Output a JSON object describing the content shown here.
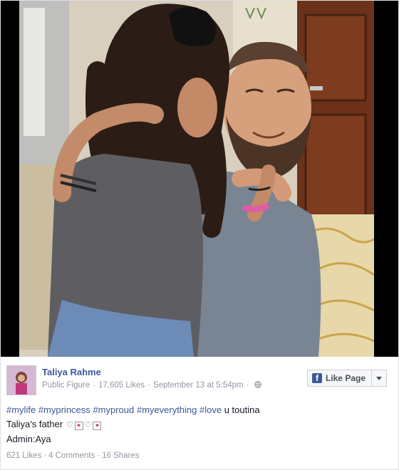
{
  "page": {
    "name": "Taliya Rahme",
    "category": "Public Figure",
    "likes": "17,605 Likes",
    "timestamp": "September 13 at 5:54pm",
    "privacy_icon": "globe-icon",
    "like_button_label": "Like Page"
  },
  "post": {
    "hashtags": [
      "#mylife",
      "#myprincess",
      "#myproud",
      "#myeverything",
      "#love"
    ],
    "line1_suffix": "u toutina",
    "line2_text": "Taliya's father",
    "line3_text": "Admin:Aya"
  },
  "stats": {
    "likes": "621 Likes",
    "comments": "4 Comments",
    "shares": "16 Shares"
  },
  "colors": {
    "link": "#3b5998",
    "meta": "#9197a3"
  }
}
